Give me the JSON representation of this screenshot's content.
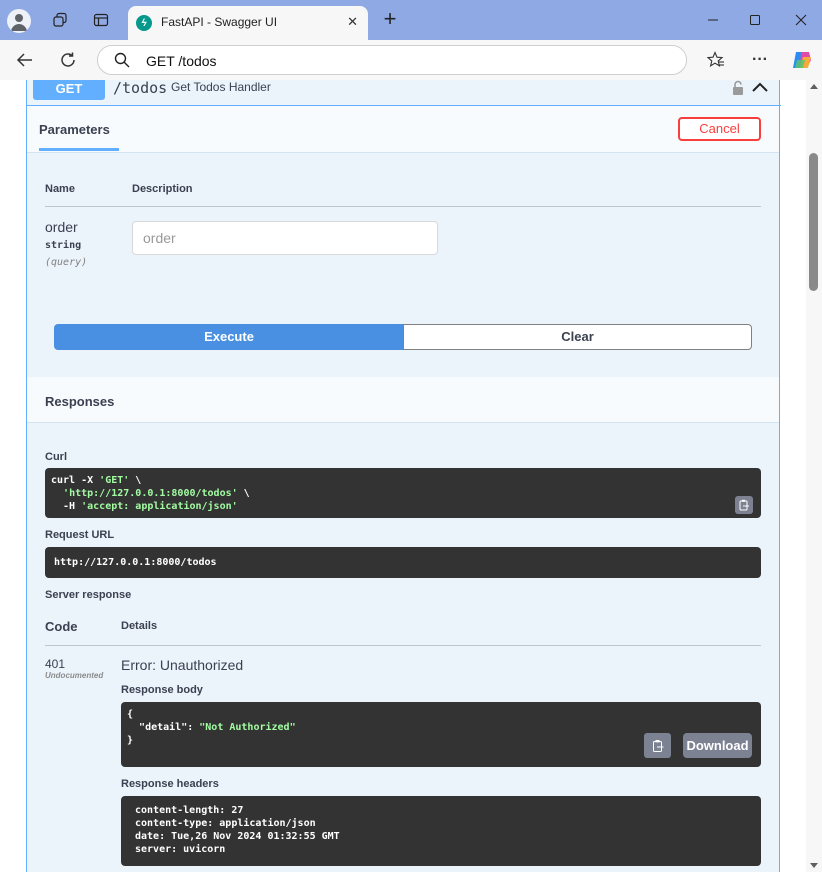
{
  "browser": {
    "tab_title": "FastAPI - Swagger UI",
    "address": "GET /todos",
    "icons": [
      "profile-icon",
      "workspaces-icon",
      "tab-actions-icon",
      "fastapi-favicon",
      "close-icon",
      "new-tab-icon",
      "minimize-icon",
      "maximize-icon",
      "window-close-icon",
      "back-icon",
      "refresh-icon",
      "search-icon",
      "favorites-icon",
      "more-icon",
      "copilot-icon"
    ]
  },
  "operation": {
    "method": "GET",
    "path": "/todos",
    "summary": "Get Todos Handler"
  },
  "parameters": {
    "tab_label": "Parameters",
    "cancel_label": "Cancel",
    "col_name": "Name",
    "col_description": "Description",
    "items": [
      {
        "name": "order",
        "type": "string",
        "in": "(query)",
        "placeholder": "order"
      }
    ]
  },
  "actions": {
    "execute": "Execute",
    "clear": "Clear"
  },
  "responses": {
    "title": "Responses",
    "curl_label": "Curl",
    "curl_lines": {
      "l1_cmd": "curl -X ",
      "l1_str": "'GET'",
      "l1_tail": " \\",
      "l2_str": "'http://127.0.0.1:8000/todos'",
      "l2_tail": " \\",
      "l3_cmd": "  -H ",
      "l3_str": "'accept: application/json'"
    },
    "request_url_label": "Request URL",
    "request_url": "http://127.0.0.1:8000/todos",
    "server_response_label": "Server response",
    "col_code": "Code",
    "col_details": "Details",
    "code": "401",
    "code_note": "Undocumented",
    "error_title": "Error: Unauthorized",
    "body_label": "Response body",
    "body": {
      "open": "{",
      "key": "\"detail\"",
      "colon": ": ",
      "value": "\"Not Authorized\"",
      "close": "}"
    },
    "download_label": "Download",
    "headers_label": "Response headers",
    "headers": [
      "content-length: 27",
      "content-type: application/json",
      "date: Tue,26 Nov 2024 01:32:55 GMT",
      "server: uvicorn"
    ]
  },
  "colors": {
    "get": "#61affe",
    "execute": "#4990e2",
    "cancel": "#f93e3e",
    "code_bg": "#333333",
    "string": "#a2fca2"
  }
}
